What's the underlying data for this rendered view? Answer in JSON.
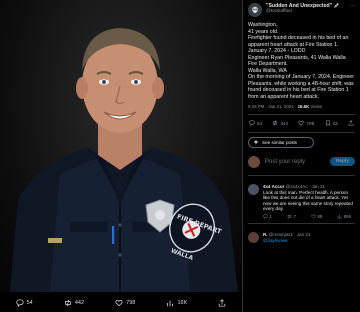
{
  "photo": {
    "alt": "firefighter portrait",
    "badge_text": "FIRE DEPARTMENT",
    "patch_text": "WALLA WALLA",
    "actions": [
      {
        "icon": "reply-icon",
        "count": "54"
      },
      {
        "icon": "retweet-icon",
        "count": "442"
      },
      {
        "icon": "like-icon",
        "count": "798"
      },
      {
        "icon": "views-icon",
        "count": "16K"
      },
      {
        "icon": "share-icon",
        "count": ""
      }
    ]
  },
  "tweet": {
    "author_name": "\"Sudden And Unexpected\" 💉",
    "author_handle": "@toobaffled",
    "body": "Washington,\n41 years old.\nFirefighter found deceased in his bed of an apparent heart attack at Fire Station 1.\nJanuary 7, 2024 - LODD\nEngineer Ryan Pleasants, 41 Walla Walla Fire Department.\nWalla Walla, WA\nOn the morning of January 7, 2024, Engineer Pleasants, while working a 48-hour shift, was found deceased in his bed at Fire Station 1 from an apparent heart attack.",
    "timestamp": "9:25 PM · Jan 21, 2024 ·",
    "views": "16.6K",
    "views_label": "Views",
    "actions": {
      "replies": "54",
      "retweets": "442",
      "likes": "798",
      "bookmarks": "33"
    },
    "similar_label": "See similar posts"
  },
  "reply": {
    "placeholder": "Post your reply",
    "button": "Reply"
  },
  "comments": [
    {
      "name": "4x4 Accor",
      "handle": "@2x4x4Ac · Jan 21",
      "text": "Look at this man. Perfect health. A person like this does not die of a heart attack. Yet now we are seeing this same story repeated every day.",
      "replies": "1",
      "retweets": "7",
      "likes": "89",
      "views": "895"
    },
    {
      "name": "R.",
      "handle": "@moonj4x1 · Jan 21",
      "link": "@Jaylnviwe"
    }
  ],
  "colors": {
    "accent": "#1d9bf0",
    "muted": "#8b98a5",
    "text": "#e7e9ea",
    "bg": "#000000"
  }
}
